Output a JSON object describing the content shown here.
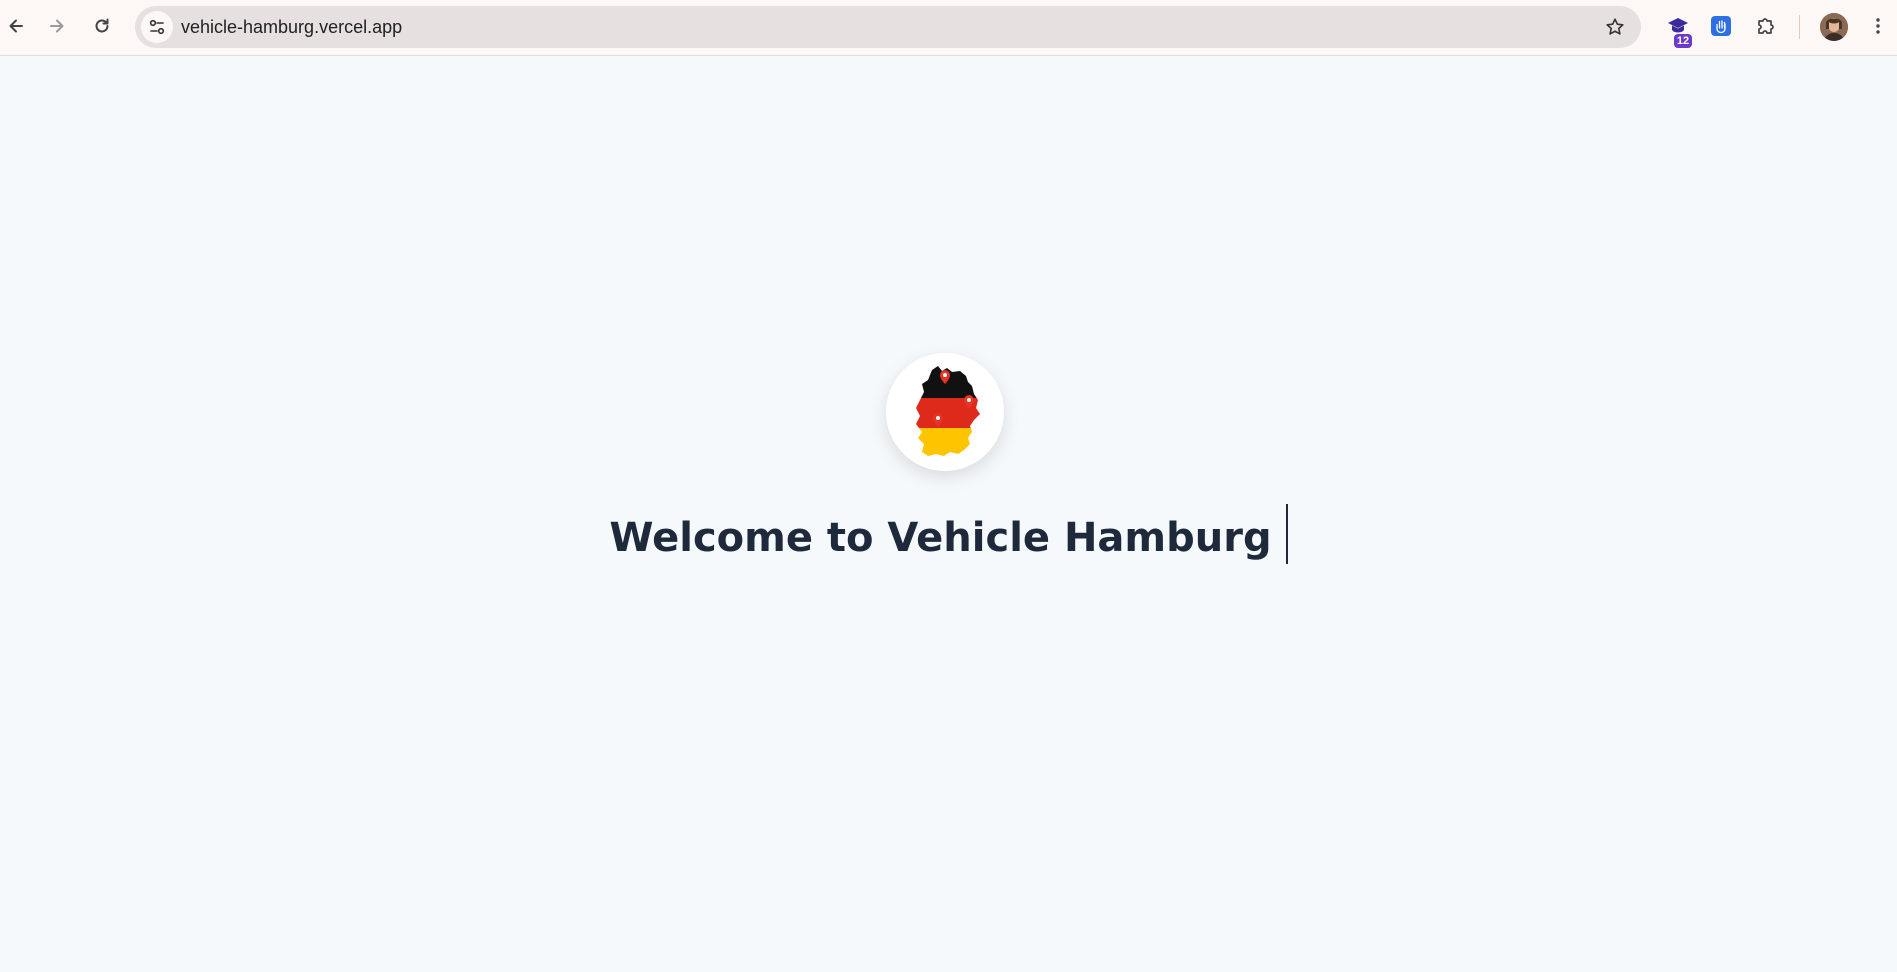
{
  "browser": {
    "url": "vehicle-hamburg.vercel.app",
    "extension_badge": "12",
    "icons": {
      "back": "arrow-left-icon",
      "forward": "arrow-right-icon",
      "reload": "reload-icon",
      "site_info": "tune-icon",
      "bookmark": "star-icon",
      "extension_one": "graduation-cap-icon",
      "extension_two": "hand-icon",
      "extensions": "puzzle-icon",
      "menu": "kebab-menu-icon"
    }
  },
  "page": {
    "headline": "Welcome to Vehicle Hamburg",
    "colors": {
      "background": "#f6f9fc",
      "headline": "#1e293b",
      "flag_black": "#111111",
      "flag_red": "#dd2a1b",
      "flag_gold": "#ffc400"
    }
  }
}
